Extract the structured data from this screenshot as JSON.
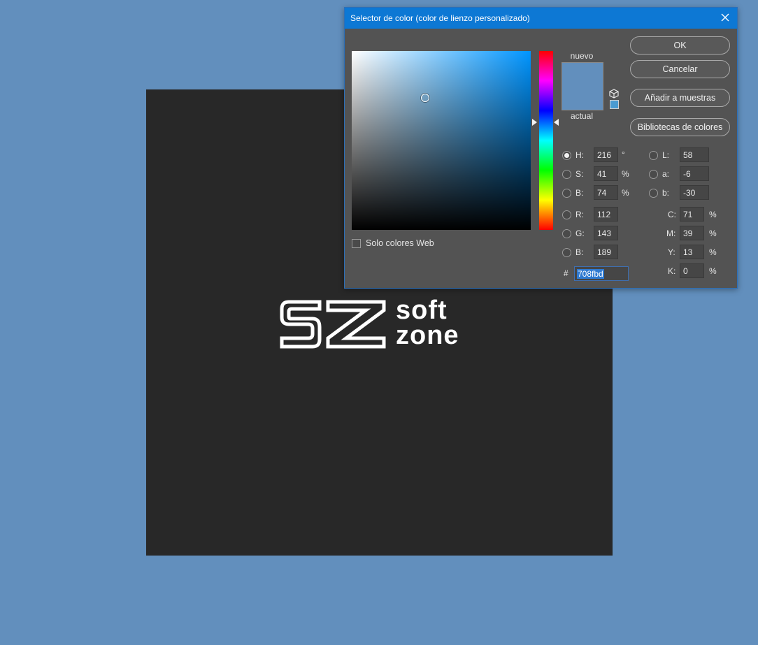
{
  "dialog": {
    "title": "Selector de color (color de lienzo personalizado)",
    "labels": {
      "new": "nuevo",
      "current": "actual"
    },
    "new_color": "#628fbd",
    "current_color": "#628fbd",
    "web_swatch_color": "#4b9bd1",
    "buttons": {
      "ok": "OK",
      "cancel": "Cancelar",
      "add_to_swatches": "Añadir a muestras",
      "color_libraries": "Bibliotecas de colores"
    },
    "web_only": {
      "label": "Solo colores Web",
      "checked": false
    },
    "hsb": {
      "h": {
        "label": "H:",
        "value": "216",
        "unit": "°"
      },
      "s": {
        "label": "S:",
        "value": "41",
        "unit": "%"
      },
      "b": {
        "label": "B:",
        "value": "74",
        "unit": "%"
      }
    },
    "rgb": {
      "r": {
        "label": "R:",
        "value": "112"
      },
      "g": {
        "label": "G:",
        "value": "143"
      },
      "b": {
        "label": "B:",
        "value": "189"
      }
    },
    "lab": {
      "l": {
        "label": "L:",
        "value": "58"
      },
      "a": {
        "label": "a:",
        "value": "-6"
      },
      "b": {
        "label": "b:",
        "value": "-30"
      }
    },
    "cmyk": {
      "c": {
        "label": "C:",
        "value": "71",
        "unit": "%"
      },
      "m": {
        "label": "M:",
        "value": "39",
        "unit": "%"
      },
      "y": {
        "label": "Y:",
        "value": "13",
        "unit": "%"
      },
      "k": {
        "label": "K:",
        "value": "0",
        "unit": "%"
      }
    },
    "hex": {
      "label": "#",
      "value": "708fbd"
    },
    "selected_mode": "H",
    "picker": {
      "saturation": 0.41,
      "brightness": 0.74,
      "hue_fraction": 0.4
    }
  },
  "canvas": {
    "background_color": "#282828",
    "logo": {
      "line1": "soft",
      "line2": "zone"
    }
  },
  "workspace_color": "#628fbd",
  "icons": {
    "close": "close-icon",
    "cube": "cube-icon"
  }
}
